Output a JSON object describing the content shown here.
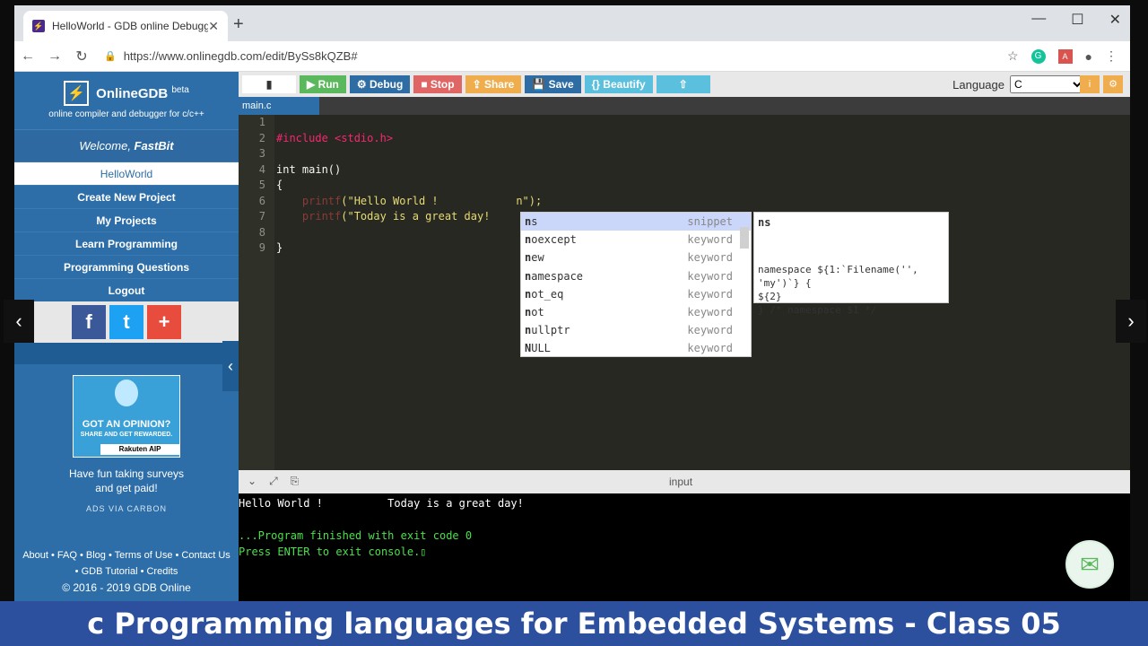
{
  "browser": {
    "tab_title": "HelloWorld - GDB online Debugg",
    "url": "https://www.onlinegdb.com/edit/BySs8kQZB#"
  },
  "sidebar": {
    "brand": "OnlineGDB",
    "brand_sup": "beta",
    "tagline": "online compiler and debugger for c/c++",
    "welcome_prefix": "Welcome, ",
    "welcome_user": "FastBit",
    "items": [
      {
        "label": "HelloWorld"
      },
      {
        "label": "Create New Project"
      },
      {
        "label": "My Projects"
      },
      {
        "label": "Learn Programming"
      },
      {
        "label": "Programming Questions"
      },
      {
        "label": "Logout"
      }
    ],
    "ad": {
      "headline": "GOT AN OPINION?",
      "sub": "SHARE AND GET REWARDED.",
      "brand": "Rakuten AIP",
      "text1": "Have fun taking surveys",
      "text2": "and get paid!",
      "via": "ADS VIA CARBON"
    },
    "footer1": "About • FAQ • Blog • Terms of Use • Contact Us",
    "footer2": "• GDB Tutorial • Credits",
    "copyright": "© 2016 - 2019 GDB Online"
  },
  "toolbar": {
    "run": "▶ Run",
    "debug": "⚙ Debug",
    "stop": "■ Stop",
    "share": "⇪ Share",
    "save": "💾 Save",
    "beautify": "{} Beautify",
    "language_label": "Language",
    "language_value": "C"
  },
  "file_tab": "main.c",
  "gutter": [
    "1",
    "2",
    "3",
    "4",
    "5",
    "6",
    "7",
    "8",
    "9"
  ],
  "code": {
    "l2": "#include <stdio.h>",
    "l4": "int main()",
    "l5": "{",
    "l6_fn": "    printf",
    "l6_str": "(\"Hello World !            n\");",
    "l7_fn": "    printf",
    "l7_str": "(\"Today is a great day!",
    "l9": "}"
  },
  "autocomplete": [
    {
      "hl": "n",
      "rest": "s",
      "meta": "snippet"
    },
    {
      "hl": "n",
      "rest": "oexcept",
      "meta": "keyword"
    },
    {
      "hl": "n",
      "rest": "ew",
      "meta": "keyword"
    },
    {
      "hl": "n",
      "rest": "amespace",
      "meta": "keyword"
    },
    {
      "hl": "n",
      "rest": "ot_eq",
      "meta": "keyword"
    },
    {
      "hl": "n",
      "rest": "ot",
      "meta": "keyword"
    },
    {
      "hl": "n",
      "rest": "ullptr",
      "meta": "keyword"
    },
    {
      "hl": "N",
      "rest": "ULL",
      "meta": "keyword"
    }
  ],
  "ac_doc": {
    "head": "ns",
    "line1": "namespace ${1:`Filename('', 'my')`} {",
    "line2": "        ${2}",
    "line3": "} /* namespace $1 */"
  },
  "console": {
    "label": "input",
    "lines": [
      "Hello World !          Today is a great day!",
      "",
      "...Program finished with exit code 0",
      "Press ENTER to exit console."
    ]
  },
  "banner": "c Programming languages for Embedded Systems - Class 05"
}
